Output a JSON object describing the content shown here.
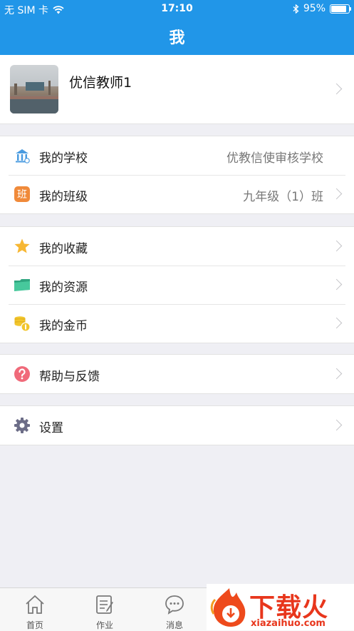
{
  "status_bar": {
    "carrier": "无 SIM 卡",
    "time": "17:10",
    "battery": "95%"
  },
  "header": {
    "title": "我"
  },
  "profile": {
    "name": "优信教师1"
  },
  "groups": [
    {
      "items": [
        {
          "label": "我的学校",
          "value": "优教信使审核学校",
          "icon": "school-icon",
          "arrow": false
        },
        {
          "label": "我的班级",
          "value": "九年级（1）班",
          "icon": "class-icon",
          "arrow": true
        }
      ]
    },
    {
      "items": [
        {
          "label": "我的收藏",
          "icon": "star-icon",
          "arrow": true
        },
        {
          "label": "我的资源",
          "icon": "folder-icon",
          "arrow": true
        },
        {
          "label": "我的金币",
          "icon": "coins-icon",
          "arrow": true
        }
      ]
    },
    {
      "items": [
        {
          "label": "帮助与反馈",
          "icon": "help-icon",
          "arrow": true
        }
      ]
    },
    {
      "items": [
        {
          "label": "设置",
          "icon": "gear-icon",
          "arrow": true
        }
      ]
    }
  ],
  "class_icon_char": "班",
  "tabs": [
    {
      "label": "首页",
      "icon": "home-icon"
    },
    {
      "label": "作业",
      "icon": "homework-icon"
    },
    {
      "label": "消息",
      "icon": "message-icon"
    }
  ],
  "watermark": {
    "title": "下载火",
    "url": "xiazaihuo.com"
  },
  "colors": {
    "accent": "#2196e8",
    "background": "#efeff4",
    "star": "#f7b733",
    "folder": "#3bbf94",
    "coins": "#f2c62d",
    "help": "#f06a7a",
    "gear": "#6c6d87"
  }
}
